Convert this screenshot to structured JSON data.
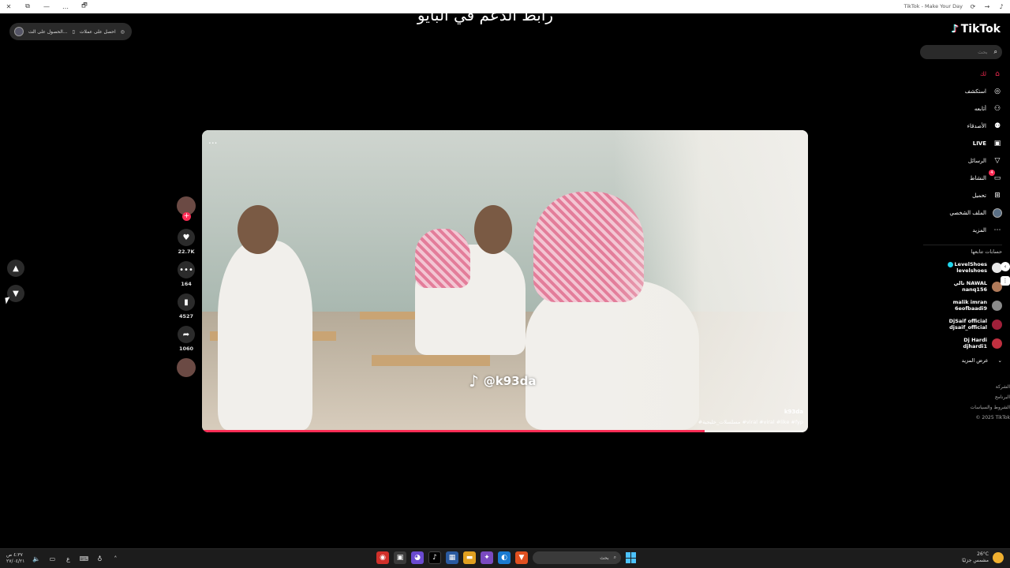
{
  "window": {
    "title": "TikTok - Make Your Day",
    "left_controls": [
      "✕",
      "⧉",
      "—",
      "…",
      "🗗"
    ]
  },
  "caption_overlay": "رابط الدعم في البايو",
  "app_pill": {
    "get_coins": "احصل على عملات",
    "get_app": "الحصول على الت..."
  },
  "video": {
    "more_label": "...",
    "watermark": "@k93da",
    "author": "k93da",
    "hashtags": "#مسلسلات_خليجية #viral #viral #like #fyp",
    "progress": 0.83
  },
  "actions": {
    "likes": "22.7K",
    "comments": "164",
    "saves": "4527",
    "shares": "1060"
  },
  "sidebar": {
    "logo": "TikTok",
    "search_placeholder": "بحث",
    "nav": [
      {
        "label": "لك",
        "icon": "home-icon",
        "active": true
      },
      {
        "label": "استكشف",
        "icon": "compass-icon"
      },
      {
        "label": "أتابعه",
        "icon": "user-follow-icon"
      },
      {
        "label": "الأصدقاء",
        "icon": "friends-icon"
      },
      {
        "label": "LIVE",
        "icon": "live-icon"
      },
      {
        "label": "الرسائل",
        "icon": "send-icon"
      },
      {
        "label": "النشاط",
        "icon": "activity-icon",
        "badge": "4"
      },
      {
        "label": "تحميل",
        "icon": "upload-icon"
      },
      {
        "label": "الملف الشخصي",
        "icon": "profile-avatar-icon"
      },
      {
        "label": "المزيد",
        "icon": "more-icon"
      }
    ],
    "following_header": "حسابات تتابعها",
    "following": [
      {
        "name": "LevelShoes",
        "handle": "levelshoes",
        "verified": true,
        "color": "#e8e8e8"
      },
      {
        "name": "تالي NAWAL",
        "handle": "nanq156",
        "color": "#b07a5a"
      },
      {
        "name": "malik imran",
        "handle": "6eofbaadi9",
        "color": "#8a8a8a"
      },
      {
        "name": "DjSaif official",
        "handle": "djsaif_official",
        "color": "#a0203a"
      },
      {
        "name": "Dj Hardi",
        "handle": "djhardi1",
        "color": "#c03040"
      }
    ],
    "see_more": "عرض المزيد",
    "footer": [
      "الشركة",
      "البرنامج",
      "الشروط والسياسات",
      "© 2025 TikTok"
    ]
  },
  "taskbar": {
    "time": "٤:٣٧ ص",
    "date": "٢٧/٠٤/٢١",
    "lang": "ع",
    "search_placeholder": "بحث",
    "weather_temp": "26°C",
    "weather_desc": "مشمس جزئيًا"
  },
  "colors": {
    "accent": "#fe2c55",
    "verified": "#20d5ec"
  }
}
